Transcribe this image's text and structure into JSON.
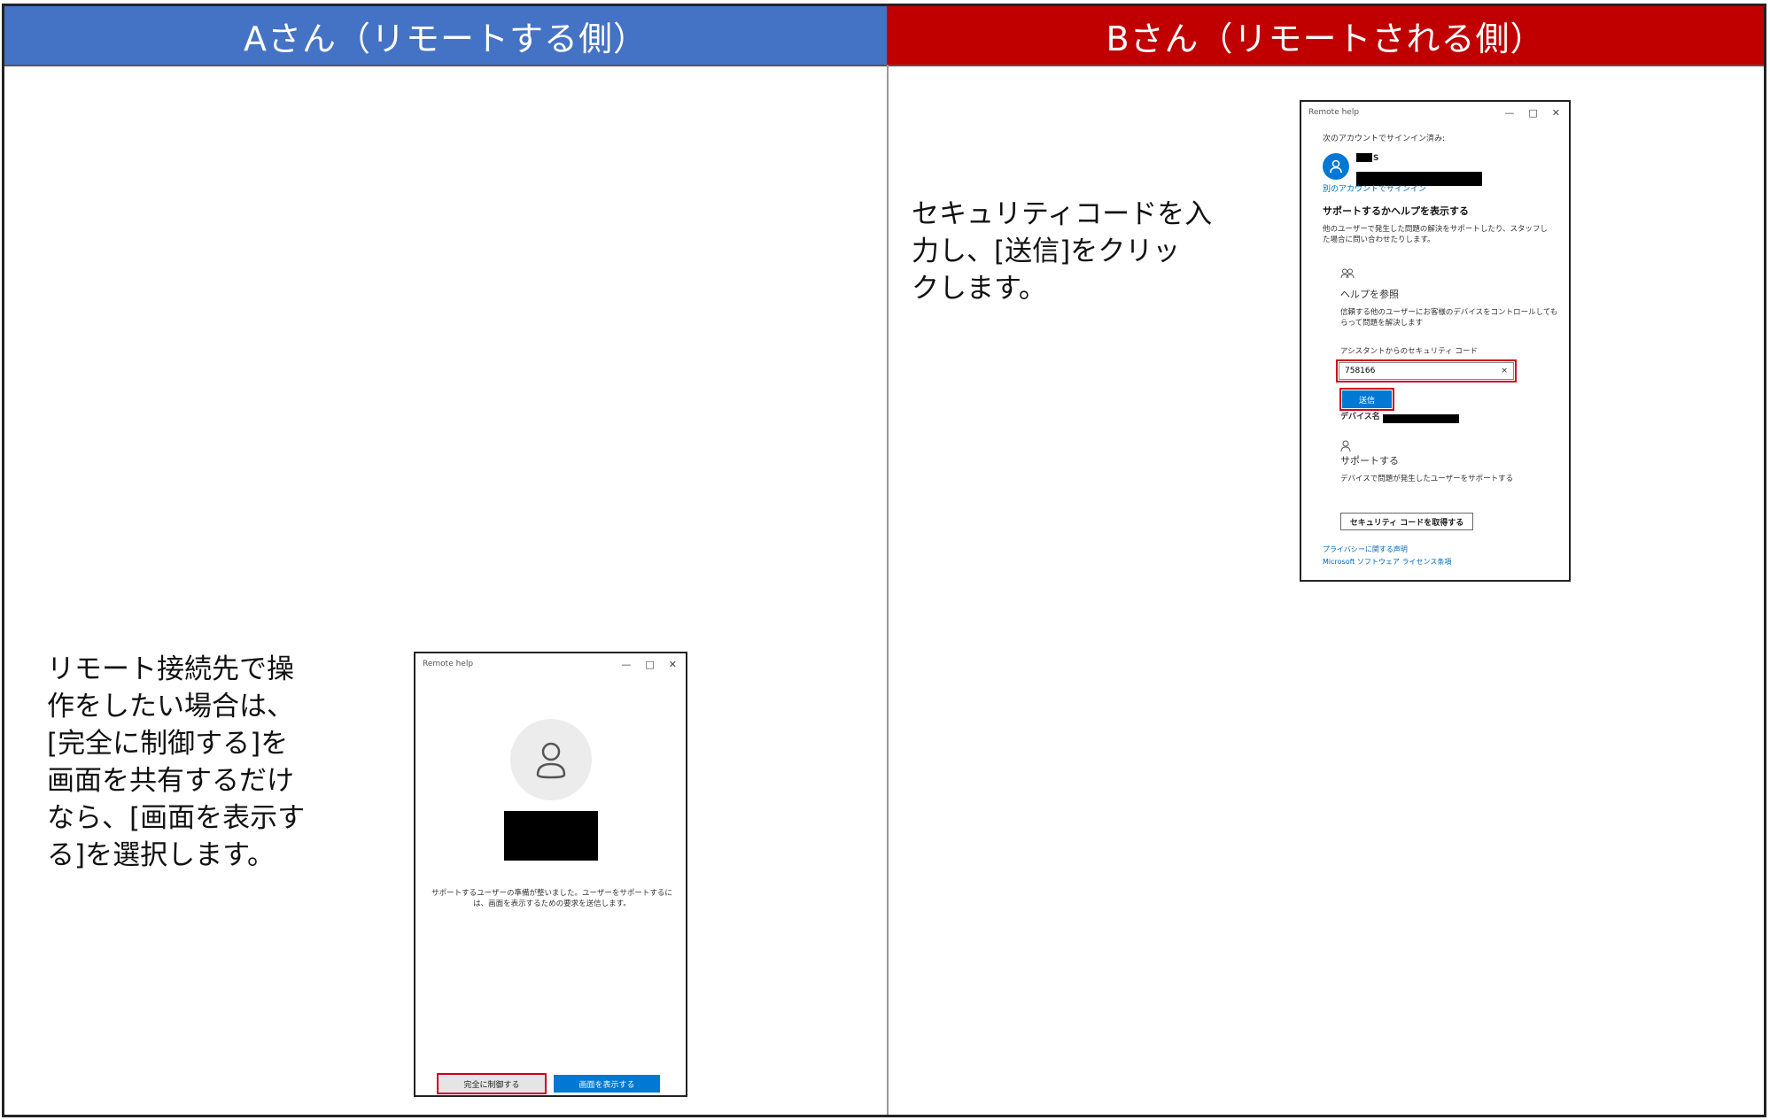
{
  "headers": {
    "a": "Aさん（リモートする側）",
    "b": "Bさん（リモートされる側）"
  },
  "instructions": {
    "a": "リモート接続先で操\n作をしたい場合は、\n[完全に制御する]を\n画面を共有するだけ\nなら、[画面を表示す\nる]を選択します。",
    "b": "セキュリティコードを入\n力し、[送信]をクリッ\nクします。"
  },
  "window_a": {
    "title": "Remote help",
    "message": "サポートするユーザーの準備が整いました。ユーザーをサポートするには、画面を表示するための要求を送信します。",
    "btn_full_control": "完全に制御する",
    "btn_view_screen": "画面を表示する"
  },
  "window_b": {
    "title": "Remote help",
    "signed_in_as": "次のアカウントでサインイン済み:",
    "user_initial": "S",
    "other_account_link": "別のアカウントでサインイン",
    "heading": "サポートするかヘルプを表示する",
    "description": "他のユーザーで発生した問題の解決をサポートしたり、スタッフした場合に問い合わせたりします。",
    "get_help_title": "ヘルプを参照",
    "get_help_desc": "信頼する他のユーザーにお客様のデバイスをコントロールしてもらって問題を解決します",
    "code_label": "アシスタントからのセキュリティ コード",
    "code_value": "758166",
    "clear_symbol": "×",
    "send_button": "送信",
    "device_name_label": "デバイス名",
    "give_help_title": "サポートする",
    "give_help_desc": "デバイスで問題が発生したユーザーをサポートする",
    "get_code_button": "セキュリティ コードを取得する",
    "privacy_link": "プライバシーに関する声明",
    "license_link": "Microsoft ソフトウェア ライセンス条項"
  },
  "icons": {
    "minimize": "—",
    "maximize": "□",
    "close": "✕"
  }
}
